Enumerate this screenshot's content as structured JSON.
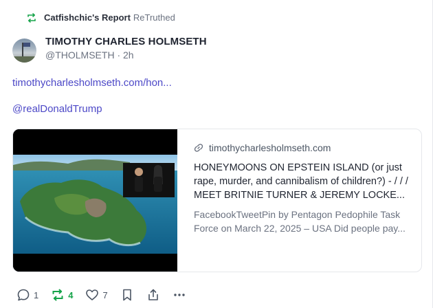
{
  "retruth_header": {
    "name": "Catfishchic's Report",
    "suffix": "ReTruthed"
  },
  "author": {
    "display_name": "TIMOTHY CHARLES HOLMSETH",
    "handle": "@THOLMSETH",
    "time": "2h"
  },
  "post": {
    "link_text": "timothycharlesholmseth.com/hon...",
    "mention": "@realDonaldTrump"
  },
  "link_card": {
    "domain": "timothycharlesholmseth.com",
    "title": "HONEYMOONS ON EPSTEIN ISLAND (or just rape, murder, and cannibalism of children?) - / / / MEET BRITNIE TURNER & JEREMY LOCKE...",
    "description": "FacebookTweetPin by Pentagon Pedophile Task Force on March 22, 2025 – USA Did people pay..."
  },
  "actions": {
    "replies": "1",
    "retruths": "4",
    "likes": "7"
  },
  "icons": {
    "retruth": "retruth-icon",
    "link": "link-icon",
    "reply": "reply-icon",
    "like": "heart-icon",
    "bookmark": "bookmark-icon",
    "share": "share-icon",
    "more": "more-icon"
  },
  "colors": {
    "accent_link": "#4c48c7",
    "retruth_green": "#16a34a",
    "muted_text": "#6b7280"
  }
}
